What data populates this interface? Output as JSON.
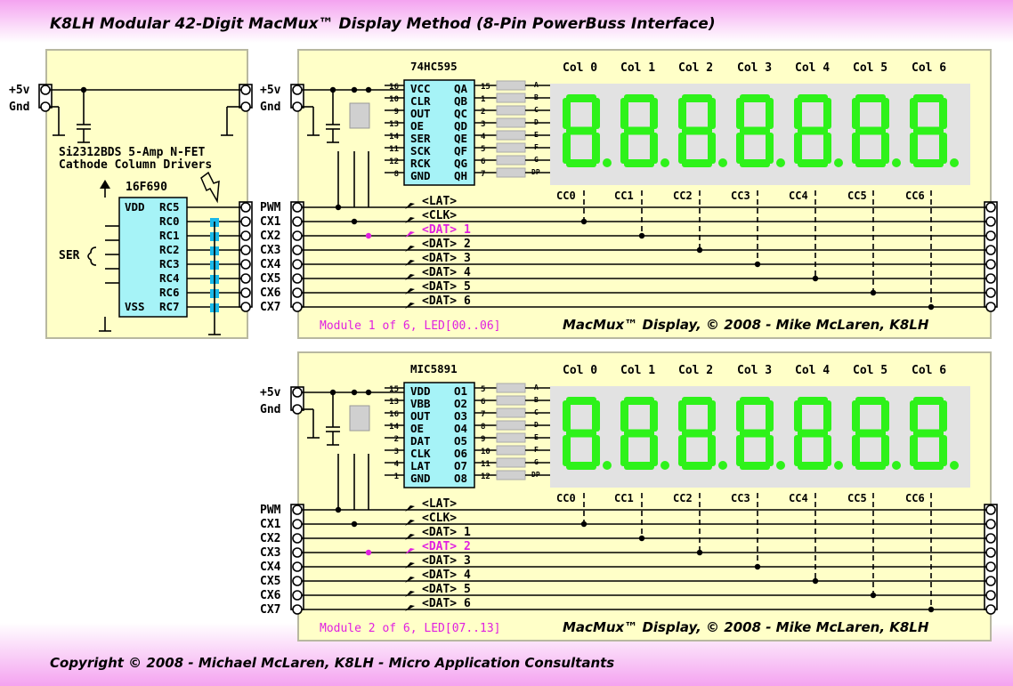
{
  "title": "K8LH Modular 42-Digit MacMux™ Display Method (8-Pin PowerBuss Interface)",
  "copyright": "Copyright © 2008 - Michael McLaren, K8LH - Micro Application Consultants",
  "driver_panel": {
    "power_labels": [
      "+5v",
      "Gnd"
    ],
    "fet_note_line1": "Si2312BDS 5-Amp N-FET",
    "fet_note_line2": "Cathode Column Drivers",
    "mcu_name": "16F690",
    "mcu_left_pins": [
      "VDD",
      "",
      "",
      "",
      "",
      "",
      "",
      "VSS"
    ],
    "mcu_right_pins": [
      "RC5",
      "RC0",
      "RC1",
      "RC2",
      "RC3",
      "RC4",
      "RC6",
      "RC7"
    ],
    "ser_label": "SER",
    "bus_labels": [
      "PWM",
      "CX1",
      "CX2",
      "CX3",
      "CX4",
      "CX5",
      "CX6",
      "CX7"
    ]
  },
  "columns": [
    "Col 0",
    "Col 1",
    "Col 2",
    "Col 3",
    "Col 4",
    "Col 5",
    "Col 6"
  ],
  "cathodes": [
    "CC0",
    "CC1",
    "CC2",
    "CC3",
    "CC4",
    "CC5",
    "CC6"
  ],
  "segments": [
    "A",
    "B",
    "C",
    "D",
    "E",
    "F",
    "G",
    "DP"
  ],
  "credit": "MacMux™ Display, © 2008 - Mike McLaren, K8LH",
  "colors": {
    "panel_fill": "#ffffc8",
    "ic_fill": "#a6f3f7",
    "segment_on": "#2ef21a",
    "display_bg": "#e2e2e2",
    "accent_magenta": "#e020e0",
    "fet_cyan": "#1ab8e8",
    "header_pink": "#f4a3f0"
  },
  "modules": [
    {
      "chip": "74HC595",
      "chip_left_pins": [
        "VCC",
        "CLR",
        "OUT",
        "OE",
        "SER",
        "SCK",
        "RCK",
        "GND"
      ],
      "chip_left_pin_nums": [
        "16",
        "10",
        "9",
        "13",
        "14",
        "11",
        "12",
        "8"
      ],
      "chip_right_pins": [
        "QA",
        "QB",
        "QC",
        "QD",
        "QE",
        "QF",
        "QG",
        "QH"
      ],
      "chip_right_pin_nums": [
        "15",
        "1",
        "2",
        "3",
        "4",
        "5",
        "6",
        "7"
      ],
      "signals": [
        "<LAT>",
        "<CLK>",
        "<DAT> 1",
        "<DAT> 2",
        "<DAT> 3",
        "<DAT> 4",
        "<DAT> 5",
        "<DAT> 6"
      ],
      "active_signal": 2,
      "label": "Module 1 of 6, LED[00..06]"
    },
    {
      "chip": "MIC5891",
      "chip_left_pins": [
        "VDD",
        "VBB",
        "OUT",
        "OE",
        "DAT",
        "CLK",
        "LAT",
        "GND"
      ],
      "chip_left_pin_nums": [
        "15",
        "13",
        "16",
        "14",
        "2",
        "3",
        "4",
        "1"
      ],
      "chip_right_pins": [
        "O1",
        "O2",
        "O3",
        "O4",
        "O5",
        "O6",
        "O7",
        "O8"
      ],
      "chip_right_pin_nums": [
        "5",
        "6",
        "7",
        "8",
        "9",
        "10",
        "11",
        "12"
      ],
      "signals": [
        "<LAT>",
        "<CLK>",
        "<DAT> 1",
        "<DAT> 2",
        "<DAT> 3",
        "<DAT> 4",
        "<DAT> 5",
        "<DAT> 6"
      ],
      "active_signal": 3,
      "label": "Module 2 of 6, LED[07..13]"
    }
  ]
}
